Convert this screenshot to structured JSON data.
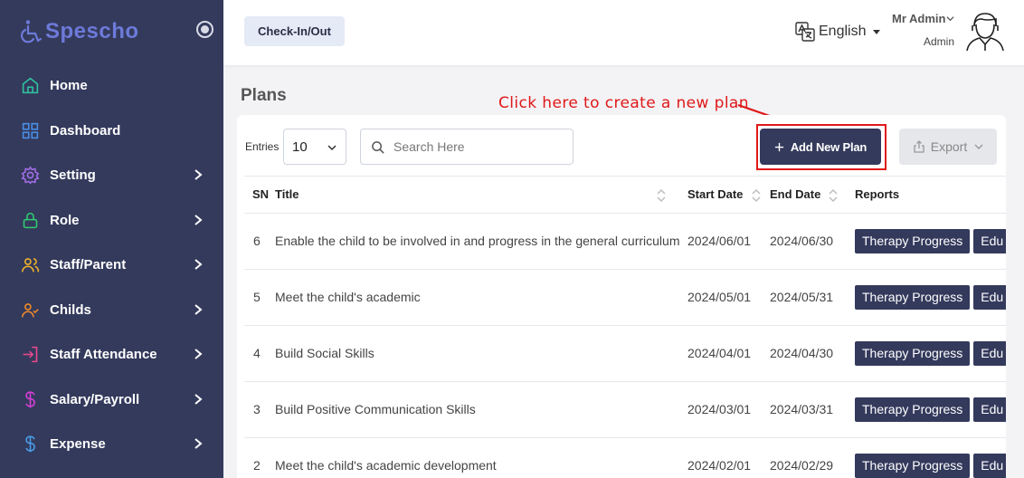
{
  "app": {
    "name": "Spescho"
  },
  "sidebar": {
    "items": [
      {
        "label": "Home",
        "icon": "home-icon",
        "icon_color": "#2ec4a0",
        "has_submenu": false
      },
      {
        "label": "Dashboard",
        "icon": "dashboard-grid-icon",
        "icon_color": "#4a8fe8",
        "has_submenu": false
      },
      {
        "label": "Setting",
        "icon": "gear-icon",
        "icon_color": "#a56ee8",
        "has_submenu": true
      },
      {
        "label": "Role",
        "icon": "lock-icon",
        "icon_color": "#2ecc71",
        "has_submenu": true
      },
      {
        "label": "Staff/Parent",
        "icon": "users-icon",
        "icon_color": "#f0b429",
        "has_submenu": true
      },
      {
        "label": "Childs",
        "icon": "user-check-icon",
        "icon_color": "#f08a29",
        "has_submenu": true
      },
      {
        "label": "Staff Attendance",
        "icon": "login-icon",
        "icon_color": "#e84a8f",
        "has_submenu": true
      },
      {
        "label": "Salary/Payroll",
        "icon": "dollar-icon",
        "icon_color": "#d63fd6",
        "has_submenu": true
      },
      {
        "label": "Expense",
        "icon": "dollar-icon",
        "icon_color": "#4a9ee8",
        "has_submenu": true
      }
    ]
  },
  "header": {
    "checkin_label": "Check-In/Out",
    "language": "English",
    "user_name": "Mr Admin",
    "user_role": "Admin"
  },
  "page": {
    "title": "Plans",
    "annotation": "Click here to create a new plan",
    "entries_label": "Entries",
    "entries_value": "10",
    "search_placeholder": "Search Here",
    "add_button": "Add New Plan",
    "export_button": "Export"
  },
  "colors": {
    "sidebar_bg": "#343a5c",
    "accent": "#343a5c",
    "annotation": "#e01818",
    "logo": "#6d7ad9"
  },
  "table": {
    "headers": {
      "sn": "SN",
      "title": "Title",
      "start": "Start Date",
      "end": "End Date",
      "reports": "Reports"
    },
    "rows": [
      {
        "sn": "6",
        "title": "Enable the child to be involved in and progress in the general curriculum",
        "start": "2024/06/01",
        "end": "2024/06/30",
        "report1": "Therapy Progress",
        "report2": "Edu"
      },
      {
        "sn": "5",
        "title": "Meet the child's academic",
        "start": "2024/05/01",
        "end": "2024/05/31",
        "report1": "Therapy Progress",
        "report2": "Edu"
      },
      {
        "sn": "4",
        "title": "Build Social Skills",
        "start": "2024/04/01",
        "end": "2024/04/30",
        "report1": "Therapy Progress",
        "report2": "Edu"
      },
      {
        "sn": "3",
        "title": "Build Positive Communication Skills",
        "start": "2024/03/01",
        "end": "2024/03/31",
        "report1": "Therapy Progress",
        "report2": "Edu"
      },
      {
        "sn": "2",
        "title": "Meet the child's academic development",
        "start": "2024/02/01",
        "end": "2024/02/29",
        "report1": "Therapy Progress",
        "report2": "Edu"
      }
    ]
  }
}
